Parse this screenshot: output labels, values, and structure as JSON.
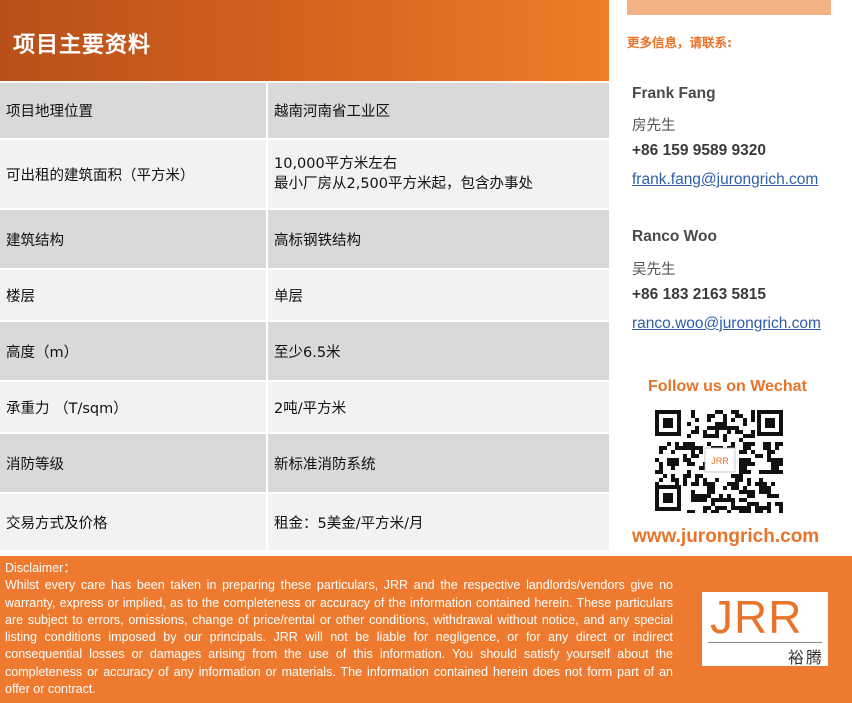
{
  "header": {
    "title": "项目主要资料"
  },
  "table": {
    "rows": [
      {
        "label": "项目地理位置",
        "value": "越南河南省工业区"
      },
      {
        "label": "可出租的建筑面积（平方米）",
        "value_line1": "10,000平方米左右",
        "value_line2": "最小厂房从2,500平方米起，包含办事处"
      },
      {
        "label": "建筑结构",
        "value": "高标钢铁结构"
      },
      {
        "label": "楼层",
        "value": "单层"
      },
      {
        "label": "高度（m）",
        "value": "至少6.5米"
      },
      {
        "label": "承重力 （T/sqm）",
        "value": "2吨/平方米"
      },
      {
        "label": "消防等级",
        "value": "新标准消防系统"
      },
      {
        "label": "交易方式及价格",
        "value": "租金：5美金/平方米/月"
      }
    ]
  },
  "contact": {
    "heading": "更多信息，请联系:",
    "people": [
      {
        "name": "Frank Fang",
        "cn_name": "房先生",
        "phone": "+86 159 9589 9320",
        "email": "frank.fang@jurongrich.com"
      },
      {
        "name": "Ranco Woo",
        "cn_name": "吴先生",
        "phone": "+86 183 2163 5815",
        "email": "ranco.woo@jurongrich.com"
      }
    ],
    "follow": "Follow us on Wechat",
    "qr_label": "JRR",
    "website": "www.jurongrich.com"
  },
  "footer": {
    "disclaimer_title": "Disclaimer：",
    "disclaimer_body": "Whilst every care has been taken in preparing these particulars, JRR and the respective landlords/vendors give no warranty, express or implied, as to the completeness or accuracy of the information contained herein. These particulars are subject to errors, omissions, change of price/rental or other conditions, withdrawal without notice, and any special listing conditions imposed by our principals. JRR will not be liable for negligence, or for any direct or indirect consequential losses or damages arising from the use of this information. You should satisfy yourself about the completeness or accuracy of any information or materials. The information contained herein does not form part of an offer or contract.",
    "logo_main": "JRR",
    "logo_sub": "裕腾"
  },
  "colors": {
    "accent": "#ee7a2f",
    "link": "#2e5ea8",
    "row_dark": "#d9d9d9",
    "row_light": "#f2f2f2"
  }
}
